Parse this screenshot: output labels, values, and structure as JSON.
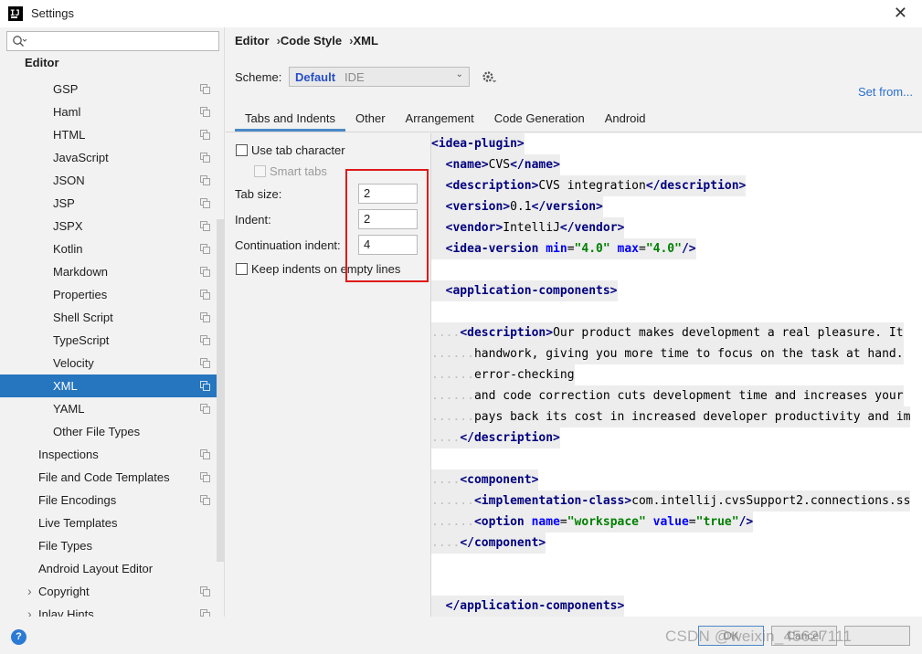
{
  "window": {
    "title": "Settings"
  },
  "left": {
    "search_placeholder": "",
    "section": "Editor",
    "items": [
      {
        "label": "GSP",
        "level": 2
      },
      {
        "label": "Haml",
        "level": 2
      },
      {
        "label": "HTML",
        "level": 2
      },
      {
        "label": "JavaScript",
        "level": 2
      },
      {
        "label": "JSON",
        "level": 2
      },
      {
        "label": "JSP",
        "level": 2
      },
      {
        "label": "JSPX",
        "level": 2
      },
      {
        "label": "Kotlin",
        "level": 2
      },
      {
        "label": "Markdown",
        "level": 2
      },
      {
        "label": "Properties",
        "level": 2
      },
      {
        "label": "Shell Script",
        "level": 2
      },
      {
        "label": "TypeScript",
        "level": 2
      },
      {
        "label": "Velocity",
        "level": 2
      },
      {
        "label": "XML",
        "level": 2,
        "selected": true
      },
      {
        "label": "YAML",
        "level": 2
      },
      {
        "label": "Other File Types",
        "level": 2,
        "noicon": true
      },
      {
        "label": "Inspections",
        "level": 1
      },
      {
        "label": "File and Code Templates",
        "level": 1
      },
      {
        "label": "File Encodings",
        "level": 1
      },
      {
        "label": "Live Templates",
        "level": 1,
        "noicon": true
      },
      {
        "label": "File Types",
        "level": 1,
        "noicon": true
      },
      {
        "label": "Android Layout Editor",
        "level": 1,
        "noicon": true
      },
      {
        "label": "Copyright",
        "level": 1,
        "arrow": true
      },
      {
        "label": "Inlay Hints",
        "level": 1,
        "arrow": true
      }
    ]
  },
  "breadcrumb": [
    "Editor",
    "Code Style",
    "XML"
  ],
  "scheme": {
    "label": "Scheme:",
    "name": "Default",
    "type": "IDE"
  },
  "set_from": "Set from...",
  "tabs": [
    "Tabs and Indents",
    "Other",
    "Arrangement",
    "Code Generation",
    "Android"
  ],
  "options": {
    "use_tab": "Use tab character",
    "smart_tabs": "Smart tabs",
    "tab_size_label": "Tab size:",
    "tab_size": "2",
    "indent_label": "Indent:",
    "indent": "2",
    "cont_label": "Continuation indent:",
    "cont": "4",
    "keep_indents": "Keep indents on empty lines"
  },
  "code_lines": [
    [
      {
        "t": "<idea-plugin>",
        "c": "tg"
      }
    ],
    [
      {
        "t": "  ",
        "c": "tx"
      },
      {
        "t": "<name>",
        "c": "tg"
      },
      {
        "t": "CVS",
        "c": "tx"
      },
      {
        "t": "</name>",
        "c": "tg"
      }
    ],
    [
      {
        "t": "  ",
        "c": "tx"
      },
      {
        "t": "<description>",
        "c": "tg"
      },
      {
        "t": "CVS integration",
        "c": "tx"
      },
      {
        "t": "</description>",
        "c": "tg"
      }
    ],
    [
      {
        "t": "  ",
        "c": "tx"
      },
      {
        "t": "<version>",
        "c": "tg"
      },
      {
        "t": "0.1",
        "c": "tx"
      },
      {
        "t": "</version>",
        "c": "tg"
      }
    ],
    [
      {
        "t": "  ",
        "c": "tx"
      },
      {
        "t": "<vendor>",
        "c": "tg"
      },
      {
        "t": "IntelliJ",
        "c": "tx"
      },
      {
        "t": "</vendor>",
        "c": "tg"
      }
    ],
    [
      {
        "t": "  ",
        "c": "tx"
      },
      {
        "t": "<idea-version ",
        "c": "tg"
      },
      {
        "t": "min",
        "c": "at"
      },
      {
        "t": "=",
        "c": "tx"
      },
      {
        "t": "\"4.0\" ",
        "c": "sv"
      },
      {
        "t": "max",
        "c": "at"
      },
      {
        "t": "=",
        "c": "tx"
      },
      {
        "t": "\"4.0\"",
        "c": "sv"
      },
      {
        "t": "/>",
        "c": "tg"
      }
    ],
    [],
    [
      {
        "t": "  ",
        "c": "tx"
      },
      {
        "t": "<application-components>",
        "c": "tg"
      }
    ],
    [],
    [
      {
        "t": "....",
        "c": "dots"
      },
      {
        "t": "<description>",
        "c": "tg"
      },
      {
        "t": "Our product makes development a real pleasure. It",
        "c": "tx"
      }
    ],
    [
      {
        "t": "......",
        "c": "dots"
      },
      {
        "t": "handwork, giving you more time to focus on the task at hand.",
        "c": "tx"
      }
    ],
    [
      {
        "t": "......",
        "c": "dots"
      },
      {
        "t": "error-checking",
        "c": "tx"
      }
    ],
    [
      {
        "t": "......",
        "c": "dots"
      },
      {
        "t": "and code correction cuts development time and increases your",
        "c": "tx"
      }
    ],
    [
      {
        "t": "......",
        "c": "dots"
      },
      {
        "t": "pays back its cost in increased developer productivity and im",
        "c": "tx"
      }
    ],
    [
      {
        "t": "....",
        "c": "dots"
      },
      {
        "t": "</description>",
        "c": "tg"
      }
    ],
    [],
    [
      {
        "t": "....",
        "c": "dots"
      },
      {
        "t": "<component>",
        "c": "tg"
      }
    ],
    [
      {
        "t": "......",
        "c": "dots"
      },
      {
        "t": "<implementation-class>",
        "c": "tg"
      },
      {
        "t": "com.intellij.cvsSupport2.connections.ss",
        "c": "tx"
      }
    ],
    [
      {
        "t": "......",
        "c": "dots"
      },
      {
        "t": "<option ",
        "c": "tg"
      },
      {
        "t": "name",
        "c": "at"
      },
      {
        "t": "=",
        "c": "tx"
      },
      {
        "t": "\"workspace\" ",
        "c": "sv"
      },
      {
        "t": "value",
        "c": "at"
      },
      {
        "t": "=",
        "c": "tx"
      },
      {
        "t": "\"true\"",
        "c": "sv"
      },
      {
        "t": "/>",
        "c": "tg"
      }
    ],
    [
      {
        "t": "....",
        "c": "dots"
      },
      {
        "t": "</component>",
        "c": "tg"
      }
    ],
    [],
    [],
    [
      {
        "t": "  ",
        "c": "tx"
      },
      {
        "t": "</application-components>",
        "c": "tg"
      }
    ]
  ],
  "buttons": {
    "help": "?",
    "ok": "OK",
    "cancel": "Cancel"
  },
  "watermark": "https://blog.csdn.net/weixin_45627111 · CSDN @weixin_45627111",
  "watermark_visible": "CSDN @weixin_45627111",
  "colors": {
    "selection": "#2675bf",
    "link": "#2a6fd0",
    "highlight_box": "#e01a1a",
    "scheme": "#2650c8"
  }
}
